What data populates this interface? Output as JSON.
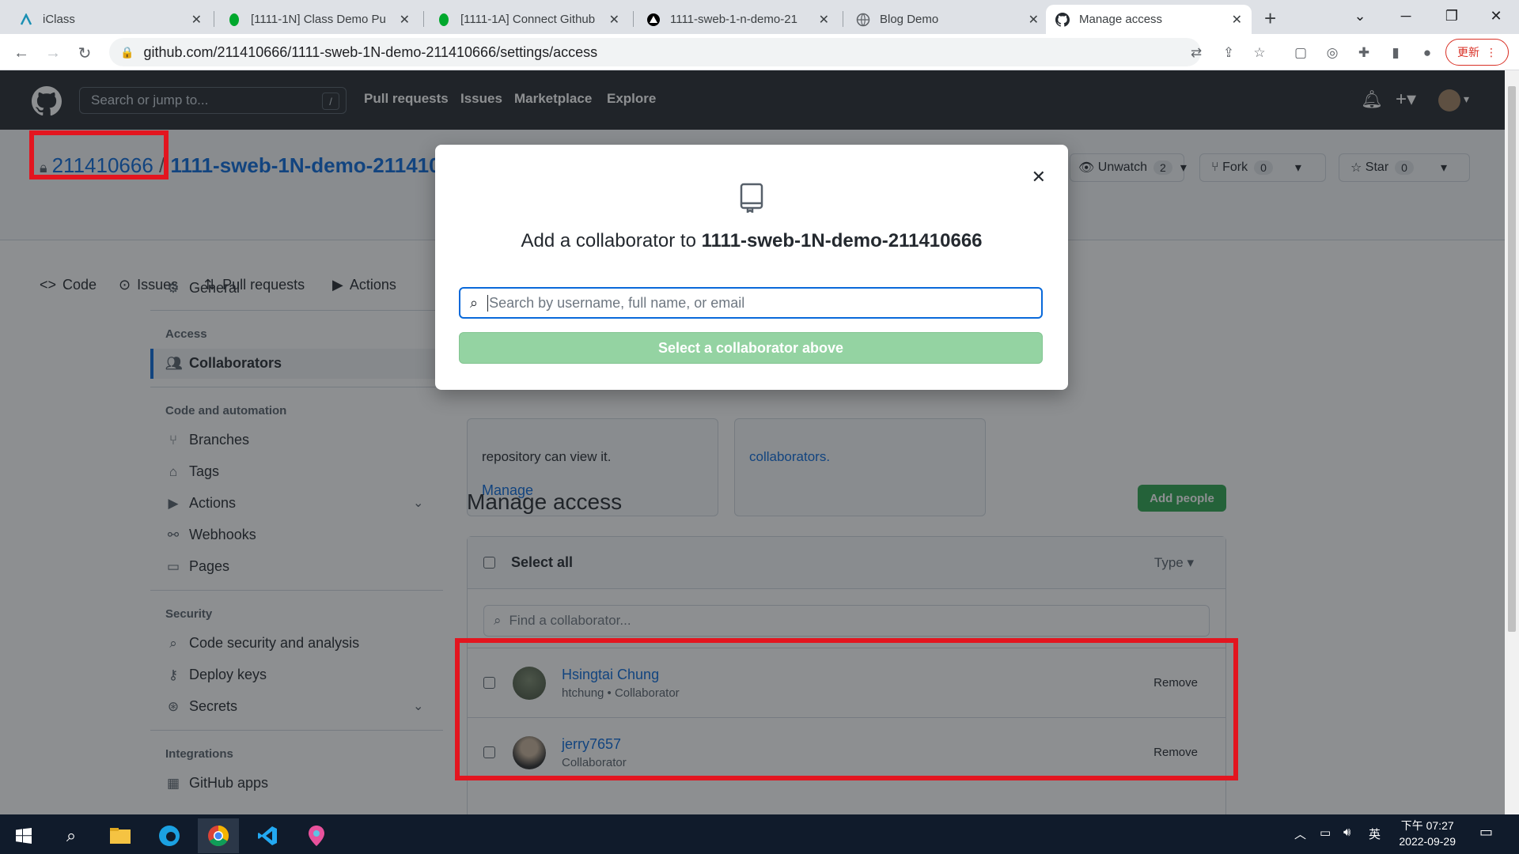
{
  "browser": {
    "tabs": [
      {
        "title": "iClass",
        "icon": "iclass-icon"
      },
      {
        "title": "[1111-1N] Class Demo Pu",
        "icon": "evernote-icon"
      },
      {
        "title": "[1111-1A] Connect Github",
        "icon": "evernote-icon"
      },
      {
        "title": "1111-sweb-1-n-demo-21",
        "icon": "vercel-icon"
      },
      {
        "title": "Blog Demo",
        "icon": "globe-icon"
      },
      {
        "title": "Manage access",
        "icon": "github-icon",
        "active": true
      }
    ],
    "new_tab": "+",
    "url": "github.com/211410666/1111-sweb-1N-demo-211410666/settings/access",
    "update_label": "更新"
  },
  "github": {
    "search_placeholder": "Search or jump to...",
    "search_shortcut": "/",
    "nav": [
      "Pull requests",
      "Issues",
      "Marketplace",
      "Explore"
    ]
  },
  "repo": {
    "owner": "211410666",
    "separator": "/",
    "name": "1111-sweb-1N-demo-211410666",
    "unwatch_label": "Unwatch",
    "unwatch_count": "2",
    "fork_label": "Fork",
    "fork_count": "0",
    "star_label": "Star",
    "star_count": "0",
    "tabs": [
      "Code",
      "Issues",
      "Pull requests",
      "Actions"
    ]
  },
  "sidebar": {
    "general": "General",
    "access_heading": "Access",
    "collaborators": "Collaborators",
    "code_heading": "Code and automation",
    "code_items": [
      "Branches",
      "Tags",
      "Actions",
      "Webhooks",
      "Pages"
    ],
    "security_heading": "Security",
    "security_items": [
      "Code security and analysis",
      "Deploy keys",
      "Secrets"
    ],
    "integrations_heading": "Integrations",
    "integrations_items": [
      "GitHub apps"
    ]
  },
  "main": {
    "card_left_text": "repository can view it.",
    "card_left_link": "Manage",
    "card_right_link": "collaborators.",
    "manage_access_title": "Manage access",
    "add_people": "Add people",
    "select_all": "Select all",
    "type_filter": "Type",
    "find_placeholder": "Find a collaborator...",
    "collaborators": [
      {
        "name": "Hsingtai Chung",
        "sub": "htchung • Collaborator",
        "action": "Remove"
      },
      {
        "name": "jerry7657",
        "sub": "Collaborator",
        "action": "Remove"
      }
    ]
  },
  "modal": {
    "title_prefix": "Add a collaborator to",
    "repo_name": "1111-sweb-1N-demo-211410666",
    "search_placeholder": "Search by username, full name, or email",
    "button": "Select a collaborator above"
  },
  "taskbar": {
    "time": "下午 07:27",
    "date": "2022-09-29",
    "ime": "英"
  },
  "colors": {
    "accent": "#0969da",
    "green": "#2da44e",
    "annotation_red": "#e3151f"
  }
}
